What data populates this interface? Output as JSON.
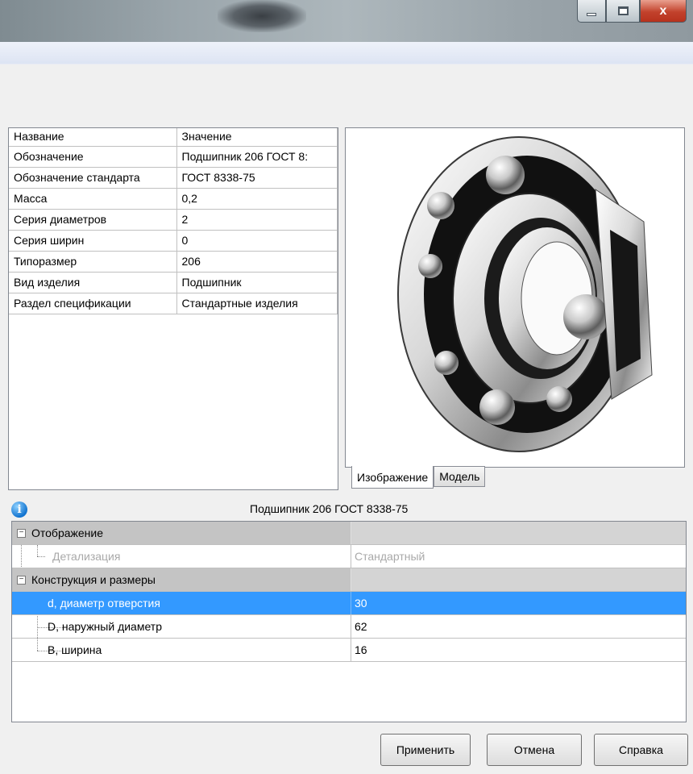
{
  "properties_table": {
    "headers": [
      "Название",
      "Значение"
    ],
    "rows": [
      [
        "Обозначение",
        "Подшипник 206 ГОСТ 8:"
      ],
      [
        "Обозначение стандарта",
        "ГОСТ 8338-75"
      ],
      [
        "Масса",
        "0,2"
      ],
      [
        "Серия диаметров",
        "2"
      ],
      [
        "Серия ширин",
        "0"
      ],
      [
        "Типоразмер",
        "206"
      ],
      [
        "Вид изделия",
        "Подшипник"
      ],
      [
        "Раздел спецификации",
        "Стандартные изделия"
      ]
    ]
  },
  "preview_tabs": {
    "image": "Изображение",
    "model": "Модель"
  },
  "info_caption": "Подшипник 206 ГОСТ 8338-75",
  "param_tree": {
    "groups": [
      {
        "name": "Отображение",
        "expander": "−",
        "items": [
          {
            "name": "Детализация",
            "value": "Стандартный",
            "state": "disabled"
          }
        ]
      },
      {
        "name": "Конструкция и размеры",
        "expander": "−",
        "items": [
          {
            "name": "d, диаметр отверстия",
            "value": "30",
            "state": "selected"
          },
          {
            "name": "D, наружный диаметр",
            "value": "62",
            "state": "normal"
          },
          {
            "name": "B, ширина",
            "value": "16",
            "state": "normal"
          }
        ]
      }
    ]
  },
  "buttons": {
    "apply": "Применить",
    "cancel": "Отмена",
    "help": "Справка"
  },
  "window_controls": {
    "close_glyph": "x"
  },
  "icons": {
    "info": "info-icon",
    "minimize": "minimize-icon",
    "maximize": "maximize-icon",
    "close": "close-icon"
  },
  "colors": {
    "selection": "#3399ff",
    "group_row": "#c4c4c4",
    "close_button": "#c2422c"
  }
}
